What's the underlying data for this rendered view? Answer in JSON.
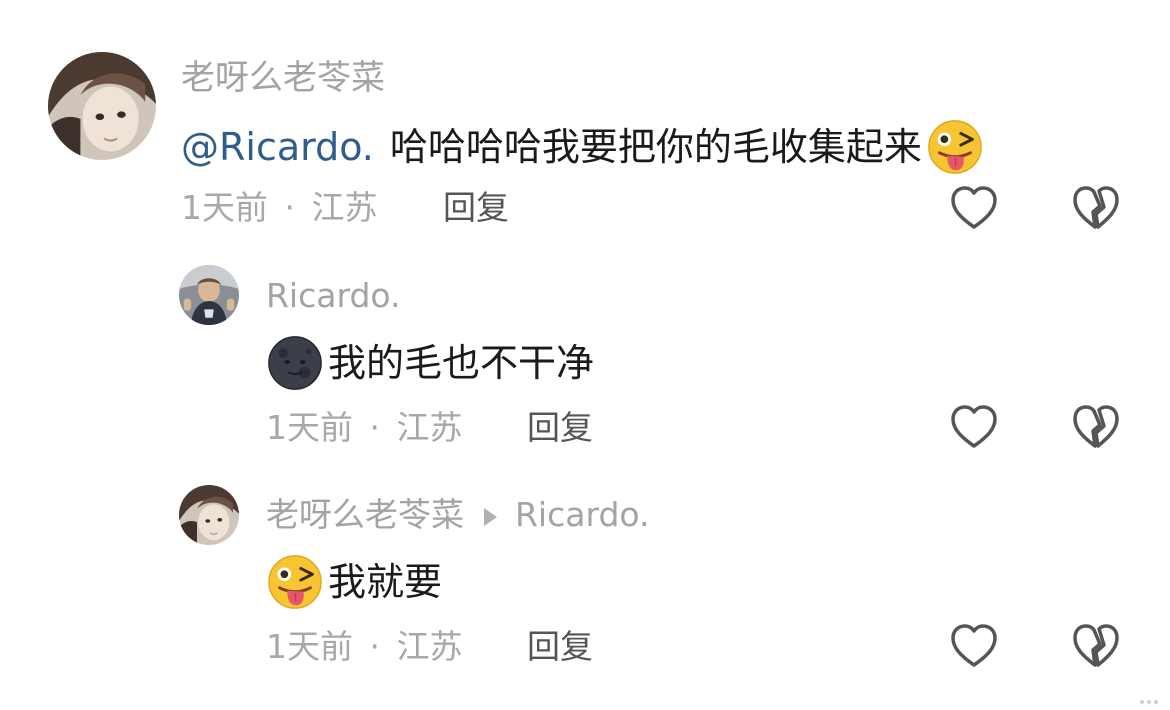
{
  "comments": [
    {
      "username": "老呀么老苓菜",
      "mention": "@Ricardo.",
      "text": "哈哈哈哈我要把你的毛收集起来",
      "emoji": "squinting-tongue-emoji",
      "time": "1天前",
      "separator": "·",
      "location": "江苏",
      "reply_label": "回复"
    },
    {
      "username": "Ricardo.",
      "emoji": "new-moon-face-emoji",
      "text": "我的毛也不干净",
      "time": "1天前",
      "separator": "·",
      "location": "江苏",
      "reply_label": "回复"
    },
    {
      "username": "老呀么老苓菜",
      "reply_to": "Ricardo.",
      "emoji": "squinting-tongue-emoji",
      "text": "我就要",
      "time": "1天前",
      "separator": "·",
      "location": "江苏",
      "reply_label": "回复"
    }
  ],
  "icons": {
    "like": "heart-outline-icon",
    "dislike": "broken-heart-outline-icon",
    "reply_arrow": "triangle-right-icon"
  },
  "colors": {
    "mention": "#2f5d8c",
    "username": "#a3a3a3",
    "meta": "#a8a8a8",
    "icon_stroke": "#555555"
  }
}
